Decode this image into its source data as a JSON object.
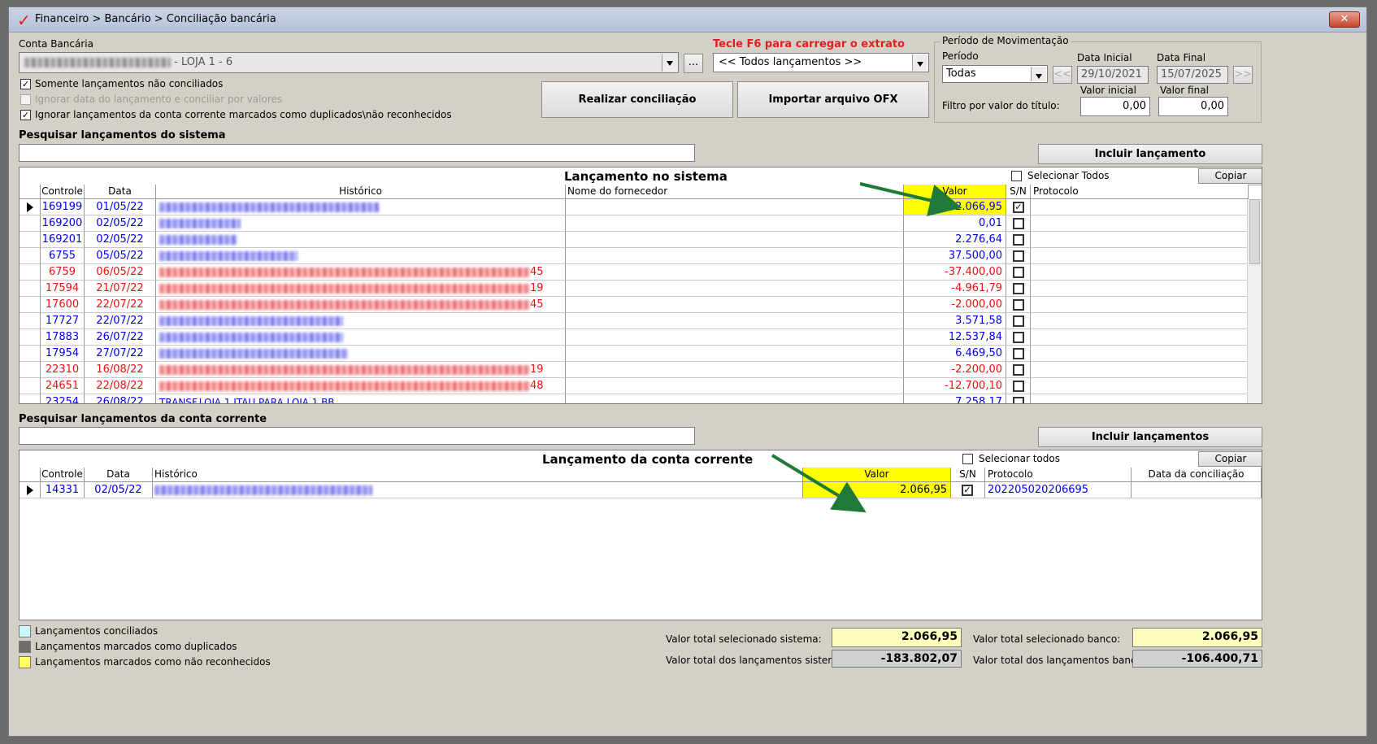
{
  "window": {
    "title": "Financeiro > Bancário > Conciliação bancária",
    "close_glyph": "✕"
  },
  "conta": {
    "label": "Conta Bancária",
    "suffix": "- LOJA 1 - 6",
    "more_glyph": "..."
  },
  "hint_f6": "Tecle F6 para carregar o extrato",
  "filter_combo": "<< Todos lançamentos >>",
  "options": [
    {
      "label": "Somente lançamentos não conciliados",
      "checked": true,
      "enabled": true
    },
    {
      "label": "Ignorar data do lançamento e conciliar por valores",
      "checked": false,
      "enabled": false
    },
    {
      "label": "Ignorar lançamentos da conta corrente marcados como duplicados\\não reconhecidos",
      "checked": true,
      "enabled": true
    }
  ],
  "buttons": {
    "realizar": "Realizar conciliação",
    "importar": "Importar arquivo OFX",
    "incluir_lancamento": "Incluir lançamento",
    "incluir_lancamentos": "Incluir lançamentos",
    "copiar": "Copiar"
  },
  "periodo": {
    "group_label": "Período de Movimentação",
    "periodo_label": "Período",
    "periodo_value": "Todas",
    "data_inicial_label": "Data Inicial",
    "data_inicial": "29/10/2021",
    "data_final_label": "Data Final",
    "data_final": "15/07/2025",
    "prev_glyph": "<<",
    "next_glyph": ">>",
    "valor_inicial_label": "Valor inicial",
    "valor_final_label": "Valor final",
    "filtro_label": "Filtro por valor do título:",
    "valor_inicial": "0,00",
    "valor_final": "0,00"
  },
  "search_sistema": {
    "label": "Pesquisar lançamentos do sistema",
    "value": ""
  },
  "search_conta": {
    "label": "Pesquisar lançamentos da conta corrente",
    "value": ""
  },
  "sistema_grid": {
    "title": "Lançamento no sistema",
    "select_all": "Selecionar Todos",
    "columns": [
      "Controle",
      "Data",
      "Histórico",
      "Nome do fornecedor",
      "Valor",
      "S/N",
      "Protocolo"
    ],
    "rows": [
      {
        "controle": "169199",
        "data": "01/05/22",
        "hist_tail": "",
        "valor": "2.066,95",
        "checked": true,
        "color": "blue",
        "selected": true
      },
      {
        "controle": "169200",
        "data": "02/05/22",
        "hist_tail": "",
        "valor": "0,01",
        "checked": false,
        "color": "blue"
      },
      {
        "controle": "169201",
        "data": "02/05/22",
        "hist_tail": "",
        "valor": "2.276,64",
        "checked": false,
        "color": "blue"
      },
      {
        "controle": "6755",
        "data": "05/05/22",
        "hist_tail": "",
        "valor": "37.500,00",
        "checked": false,
        "color": "blue"
      },
      {
        "controle": "6759",
        "data": "06/05/22",
        "hist_tail": "45",
        "valor": "-37.400,00",
        "checked": false,
        "color": "red"
      },
      {
        "controle": "17594",
        "data": "21/07/22",
        "hist_tail": "19",
        "valor": "-4.961,79",
        "checked": false,
        "color": "red"
      },
      {
        "controle": "17600",
        "data": "22/07/22",
        "hist_tail": "45",
        "valor": "-2.000,00",
        "checked": false,
        "color": "red"
      },
      {
        "controle": "17727",
        "data": "22/07/22",
        "hist_tail": "",
        "valor": "3.571,58",
        "checked": false,
        "color": "blue"
      },
      {
        "controle": "17883",
        "data": "26/07/22",
        "hist_tail": "",
        "valor": "12.537,84",
        "checked": false,
        "color": "blue"
      },
      {
        "controle": "17954",
        "data": "27/07/22",
        "hist_tail": "",
        "valor": "6.469,50",
        "checked": false,
        "color": "blue"
      },
      {
        "controle": "22310",
        "data": "16/08/22",
        "hist_tail": "19",
        "valor": "-2.200,00",
        "checked": false,
        "color": "red"
      },
      {
        "controle": "24651",
        "data": "22/08/22",
        "hist_tail": "48",
        "valor": "-12.700,10",
        "checked": false,
        "color": "red"
      },
      {
        "controle": "23254",
        "data": "26/08/22",
        "hist_tail": "TRANSF.LOJA 1 ITAU PARA LOJA 1 BB",
        "valor": "7.258,17",
        "checked": false,
        "color": "blue"
      }
    ]
  },
  "conta_grid": {
    "title": "Lançamento da conta corrente",
    "select_all": "Selecionar todos",
    "columns": [
      "Controle",
      "Data",
      "Histórico",
      "Valor",
      "S/N",
      "Protocolo",
      "Data da conciliação"
    ],
    "rows": [
      {
        "controle": "14331",
        "data": "02/05/22",
        "valor": "2.066,95",
        "checked": true,
        "protocolo": "202205020206695",
        "data_conc": ""
      }
    ]
  },
  "legend": [
    {
      "label": "Lançamentos conciliados",
      "color": "#ccf7fb"
    },
    {
      "label": "Lançamentos marcados como duplicados",
      "color": "#6e6e6e"
    },
    {
      "label": "Lançamentos marcados como não reconhecidos",
      "color": "#ffff66"
    }
  ],
  "totals": {
    "sel_sistema_label": "Valor total selecionado sistema:",
    "sel_sistema": "2.066,95",
    "sel_banco_label": "Valor total selecionado banco:",
    "sel_banco": "2.066,95",
    "tot_sistema_label": "Valor total dos lançamentos sistema:",
    "tot_sistema": "-183.802,07",
    "tot_banco_label": "Valor total dos lançamentos banco:",
    "tot_banco": "-106.400,71"
  },
  "colors": {
    "highlight": "#ffff00",
    "arrow": "#1f7a3a",
    "link_blue": "#0000ee",
    "negative_red": "#ee1111"
  }
}
